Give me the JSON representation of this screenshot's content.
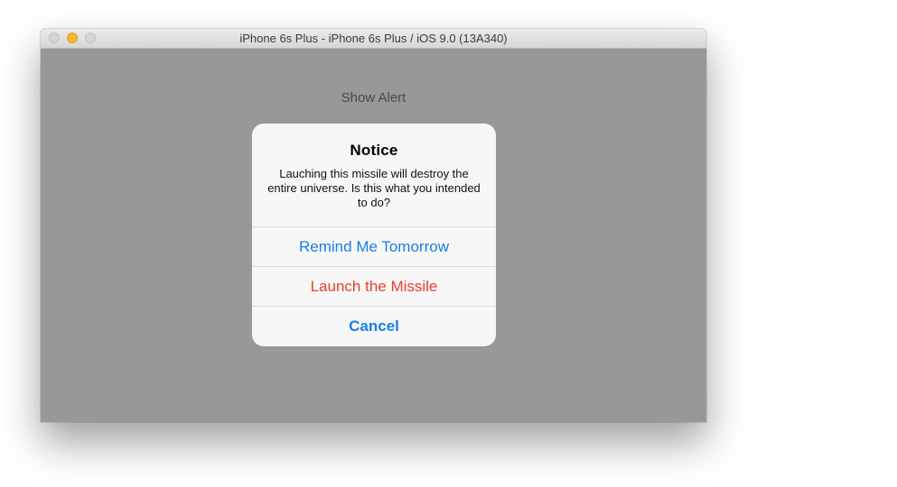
{
  "window": {
    "title": "iPhone 6s Plus - iPhone 6s Plus / iOS 9.0 (13A340)"
  },
  "app": {
    "show_alert_label": "Show Alert"
  },
  "alert": {
    "title": "Notice",
    "message": "Lauching this missile will destroy the entire universe. Is this what you intended to do?",
    "actions": [
      {
        "label": "Remind Me Tomorrow",
        "style": "default"
      },
      {
        "label": "Launch the Missile",
        "style": "destructive"
      },
      {
        "label": "Cancel",
        "style": "cancel"
      }
    ]
  },
  "colors": {
    "ios_blue": "#1a7ee6",
    "destructive_red": "#e8412f",
    "dimmed_background": "#989898",
    "minimize_yellow": "#f4b835"
  }
}
